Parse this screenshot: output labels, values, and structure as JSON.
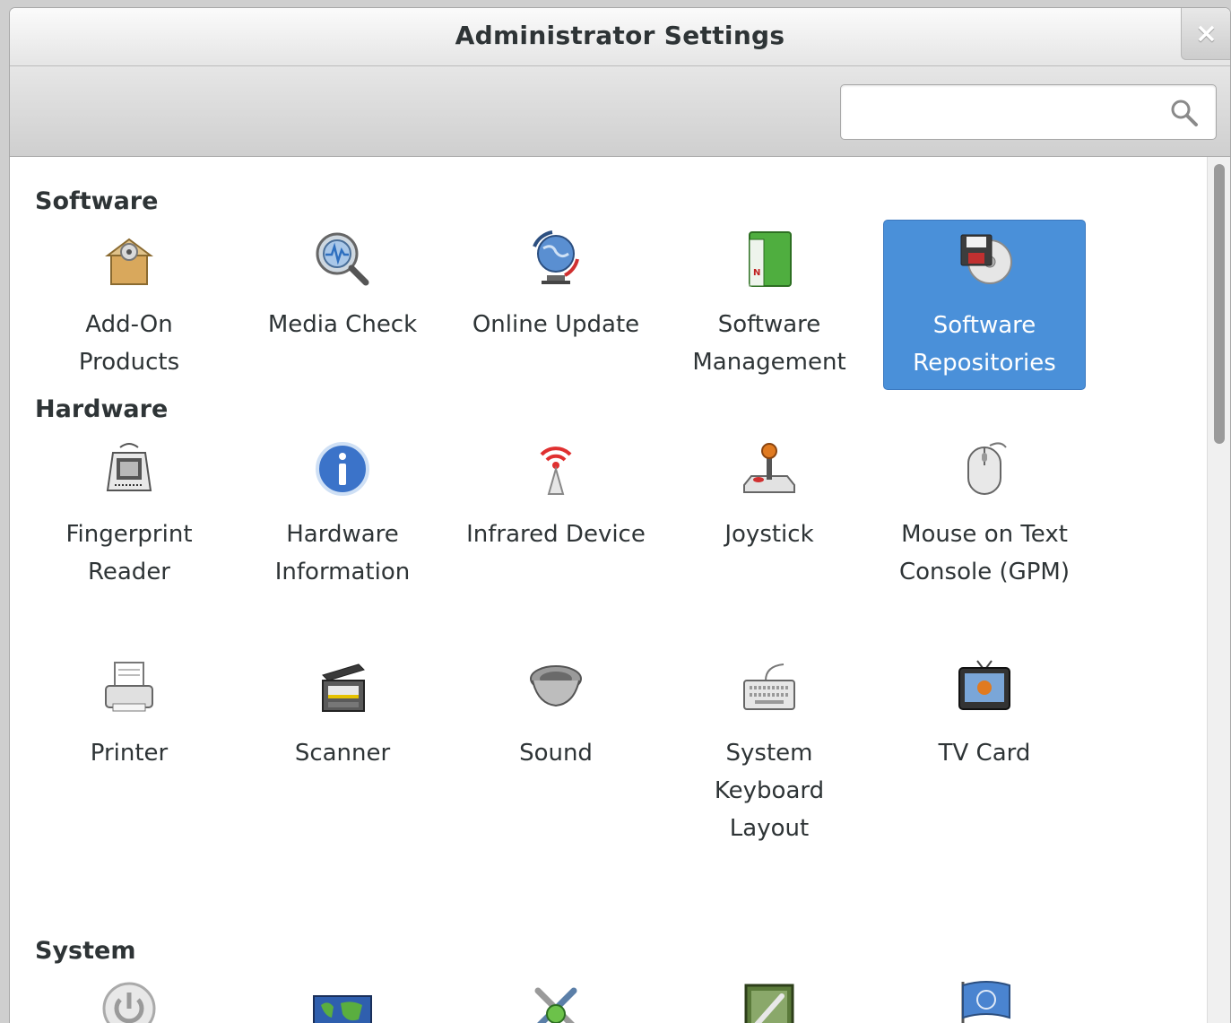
{
  "window": {
    "title": "Administrator Settings",
    "close_label": "×"
  },
  "search": {
    "value": "",
    "placeholder": ""
  },
  "sections": {
    "software": {
      "title": "Software",
      "items": [
        {
          "label": "Add-On Products",
          "icon": "addon-package-icon"
        },
        {
          "label": "Media Check",
          "icon": "media-check-icon"
        },
        {
          "label": "Online Update",
          "icon": "online-update-icon"
        },
        {
          "label": "Software Management",
          "icon": "software-management-icon"
        },
        {
          "label": "Software Repositories",
          "icon": "software-repositories-icon",
          "selected": true
        }
      ]
    },
    "hardware": {
      "title": "Hardware",
      "items": [
        {
          "label": "Fingerprint Reader",
          "icon": "fingerprint-reader-icon"
        },
        {
          "label": "Hardware Information",
          "icon": "info-icon"
        },
        {
          "label": "Infrared Device",
          "icon": "infrared-icon"
        },
        {
          "label": "Joystick",
          "icon": "joystick-icon"
        },
        {
          "label": "Mouse on Text Console (GPM)",
          "icon": "mouse-icon"
        },
        {
          "label": "Printer",
          "icon": "printer-icon"
        },
        {
          "label": "Scanner",
          "icon": "scanner-icon"
        },
        {
          "label": "Sound",
          "icon": "sound-icon"
        },
        {
          "label": "System Keyboard Layout",
          "icon": "keyboard-icon"
        },
        {
          "label": "TV Card",
          "icon": "tv-card-icon"
        }
      ]
    },
    "system": {
      "title": "System",
      "items": [
        {
          "icon": "power-icon"
        },
        {
          "icon": "world-map-icon"
        },
        {
          "icon": "tools-icon"
        },
        {
          "icon": "kernel-settings-icon"
        },
        {
          "icon": "language-flag-icon"
        }
      ]
    }
  },
  "colors": {
    "selection": "#4a90d9",
    "text": "#2e3436"
  }
}
